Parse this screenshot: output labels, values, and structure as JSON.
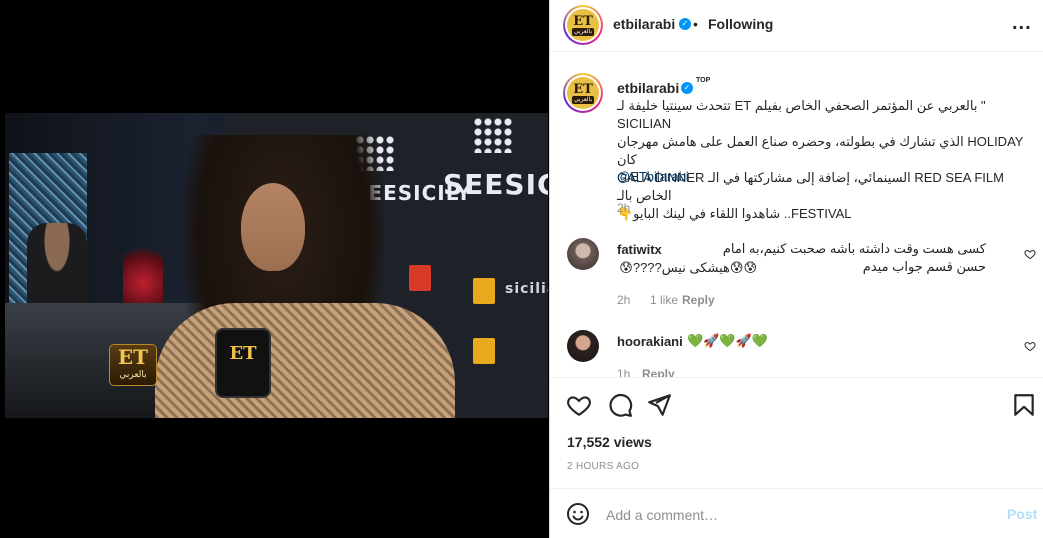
{
  "media": {
    "brand_text_1": "SEESICILY",
    "brand_text_2": "SEESICIL",
    "brand_text_3": "siciliafilm",
    "badge_main": "ET",
    "badge_sub": "بالعربي",
    "mic_text": "ET"
  },
  "header": {
    "username": "etbilarabi",
    "separator": "•",
    "follow_status": "Following",
    "more_label": "..."
  },
  "post": {
    "username": "etbilarabi",
    "top_badge": "TOP",
    "caption_lines": [
      "\" بالعربي عن المؤتمر الصحفي الخاص بفيلم ET تتحدث سينتيا خليفة لـ SICILIAN",
      "HOLIDAY الذي تشارك في بطولته، وحضره صناع العمل على هامش مهرجان كان",
      "RED SEA FILM السينمائي، إضافة إلى مشاركتها في الـ GALA DINNER الخاص بالـ",
      "FESTIVAL.. شاهدوا اللقاء في لينك البايو👇"
    ],
    "mention": "@ETbilarabi",
    "time": "2h"
  },
  "comments": [
    {
      "username": "fatiwitx",
      "text_line_1": "کسی هست وقت داشته باشه صحبت کنیم،به امام حسن قسم جواب میدم",
      "text_line_2": "😰😰هیشکی نیس????😰",
      "time": "2h",
      "likes": "1 like",
      "reply": "Reply"
    },
    {
      "username": "hoorakiani",
      "text_line_1": "💚🚀💚🚀💚",
      "time": "1h",
      "reply": "Reply"
    }
  ],
  "stats": {
    "views": "17,552 views",
    "posted_ago": "2 HOURS AGO"
  },
  "composer": {
    "placeholder": "Add a comment…",
    "post_label": "Post"
  },
  "colors": {
    "accent_blue": "#0095f6",
    "post_disabled": "#b2dffc",
    "mention": "#00376b"
  }
}
